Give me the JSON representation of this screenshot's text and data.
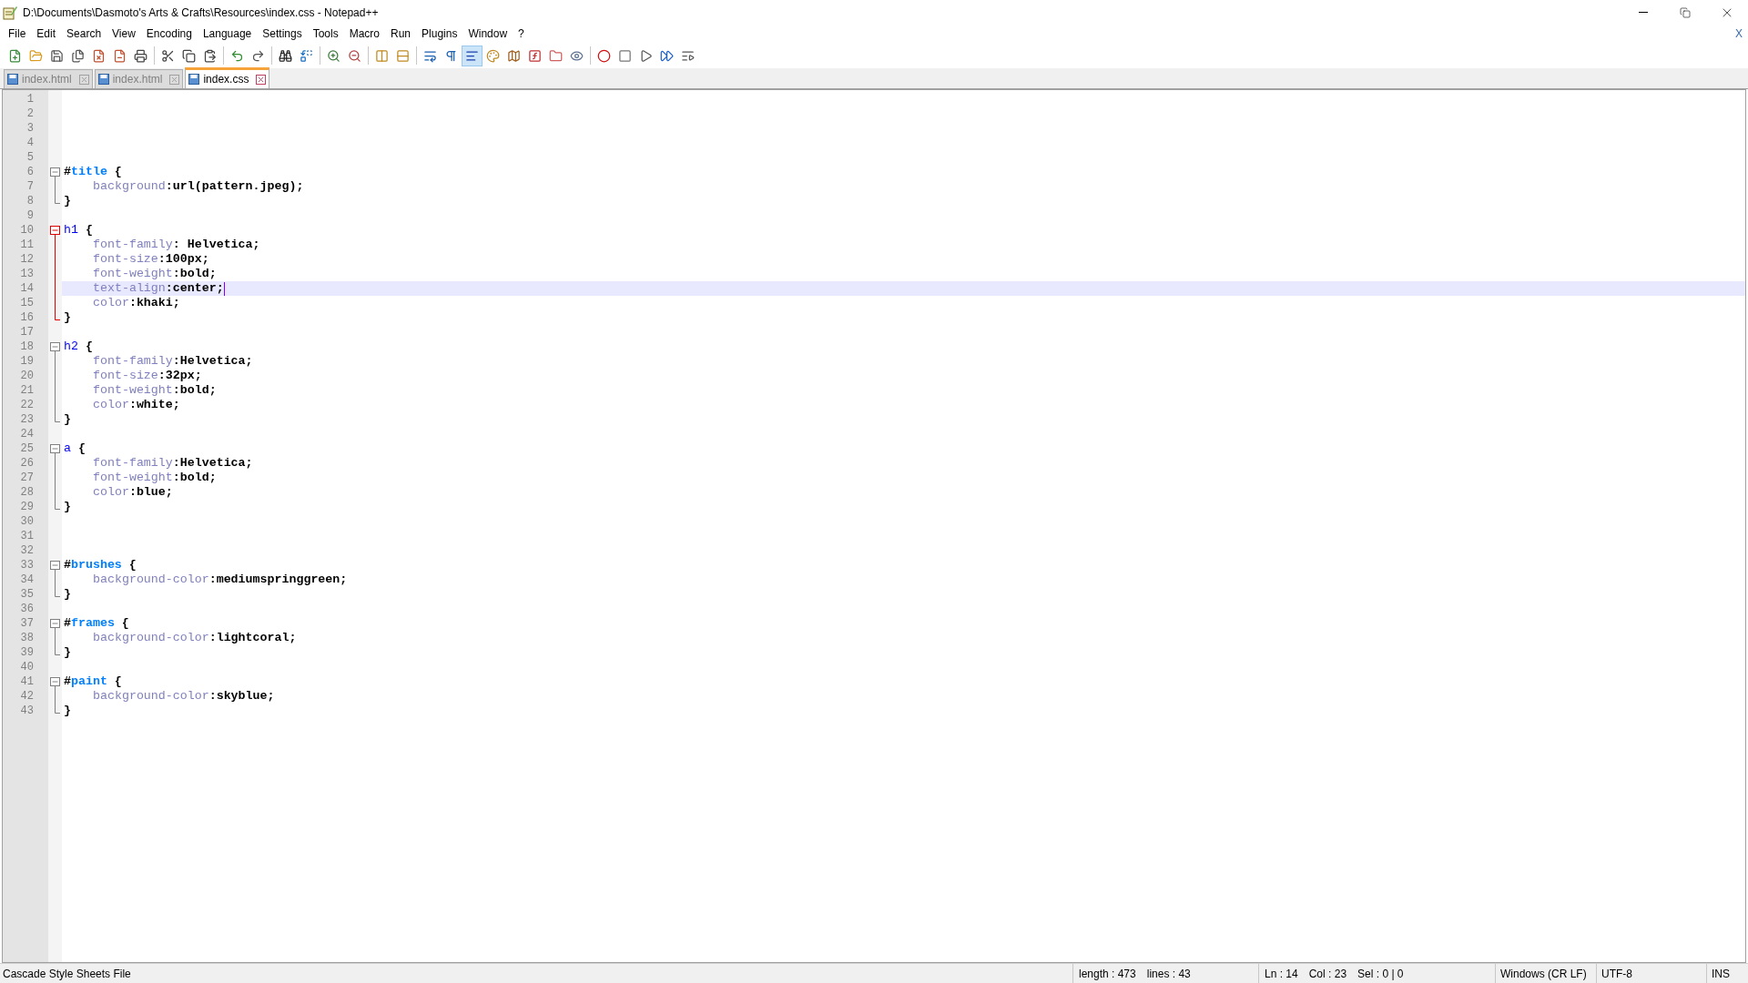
{
  "window": {
    "title": "D:\\Documents\\Dasmoto's Arts & Crafts\\Resources\\index.css - Notepad++"
  },
  "menu": [
    "File",
    "Edit",
    "Search",
    "View",
    "Encoding",
    "Language",
    "Settings",
    "Tools",
    "Macro",
    "Run",
    "Plugins",
    "Window",
    "?"
  ],
  "menu_close": "X",
  "toolbar_buttons": [
    {
      "pressed": false
    },
    {
      "pressed": false
    },
    {
      "pressed": false
    },
    {
      "pressed": false
    },
    {
      "pressed": false
    },
    {
      "pressed": false
    },
    {
      "pressed": false
    },
    {
      "pressed": false
    },
    {
      "pressed": false
    },
    {
      "pressed": false
    },
    {
      "pressed": false
    },
    {
      "pressed": false
    },
    {
      "pressed": false
    },
    {
      "pressed": false
    },
    {
      "pressed": false
    },
    {
      "pressed": false
    },
    {
      "pressed": false
    },
    {
      "pressed": false
    },
    {
      "pressed": false
    },
    {
      "pressed": false
    },
    {
      "pressed": true
    },
    {
      "pressed": false
    },
    {
      "pressed": false
    },
    {
      "pressed": false
    },
    {
      "pressed": false
    },
    {
      "pressed": false
    },
    {
      "pressed": false
    },
    {
      "pressed": false
    },
    {
      "pressed": false
    },
    {
      "pressed": false
    },
    {
      "pressed": false
    }
  ],
  "tabs": [
    {
      "label": "index.html",
      "selected": false
    },
    {
      "label": "index.html",
      "selected": false
    },
    {
      "label": "index.css",
      "selected": true
    }
  ],
  "lines": [
    {
      "number": "1",
      "kind": "blank",
      "current": false
    },
    {
      "number": "2",
      "kind": "blank",
      "current": false
    },
    {
      "number": "3",
      "kind": "blank",
      "current": false
    },
    {
      "number": "4",
      "kind": "blank",
      "current": false
    },
    {
      "number": "5",
      "kind": "blank",
      "current": false
    },
    {
      "number": "6",
      "kind": "open",
      "current": false,
      "fold_active": false,
      "tokens": [
        {
          "kind": "op",
          "text": "#"
        },
        {
          "kind": "id",
          "text": "title"
        },
        {
          "kind": "op",
          "text": " {"
        }
      ]
    },
    {
      "number": "7",
      "kind": "body",
      "current": false,
      "fold_active": false,
      "tokens": [
        {
          "kind": "prop",
          "text": "background"
        },
        {
          "kind": "value",
          "text": ":url(pattern.jpeg);"
        }
      ]
    },
    {
      "number": "8",
      "kind": "close",
      "current": false,
      "fold_active": false,
      "tokens": [
        {
          "kind": "op",
          "text": "}"
        }
      ]
    },
    {
      "number": "9",
      "kind": "blank",
      "current": false
    },
    {
      "number": "10",
      "kind": "open",
      "current": false,
      "fold_active": true,
      "tokens": [
        {
          "kind": "tag",
          "text": "h1"
        },
        {
          "kind": "op",
          "text": " {"
        }
      ]
    },
    {
      "number": "11",
      "kind": "body",
      "current": false,
      "fold_active": true,
      "tokens": [
        {
          "kind": "prop",
          "text": "font-family"
        },
        {
          "kind": "value",
          "text": ": Helvetica;"
        }
      ]
    },
    {
      "number": "12",
      "kind": "body",
      "current": false,
      "fold_active": true,
      "tokens": [
        {
          "kind": "prop",
          "text": "font-size"
        },
        {
          "kind": "value",
          "text": ":100px;"
        }
      ]
    },
    {
      "number": "13",
      "kind": "body",
      "current": false,
      "fold_active": true,
      "tokens": [
        {
          "kind": "prop",
          "text": "font-weight"
        },
        {
          "kind": "value",
          "text": ":bold;"
        }
      ]
    },
    {
      "number": "14",
      "kind": "body",
      "current": true,
      "fold_active": true,
      "tokens": [
        {
          "kind": "prop",
          "text": "text-align"
        },
        {
          "kind": "value",
          "text": ":center;"
        }
      ]
    },
    {
      "number": "15",
      "kind": "body",
      "current": false,
      "fold_active": true,
      "tokens": [
        {
          "kind": "prop",
          "text": "color"
        },
        {
          "kind": "value",
          "text": ":khaki;"
        }
      ]
    },
    {
      "number": "16",
      "kind": "close",
      "current": false,
      "fold_active": true,
      "tokens": [
        {
          "kind": "op",
          "text": "}"
        }
      ]
    },
    {
      "number": "17",
      "kind": "blank",
      "current": false
    },
    {
      "number": "18",
      "kind": "open",
      "current": false,
      "fold_active": false,
      "tokens": [
        {
          "kind": "tag",
          "text": "h2"
        },
        {
          "kind": "op",
          "text": " {"
        }
      ]
    },
    {
      "number": "19",
      "kind": "body",
      "current": false,
      "fold_active": false,
      "tokens": [
        {
          "kind": "prop",
          "text": "font-family"
        },
        {
          "kind": "value",
          "text": ":Helvetica;"
        }
      ]
    },
    {
      "number": "20",
      "kind": "body",
      "current": false,
      "fold_active": false,
      "tokens": [
        {
          "kind": "prop",
          "text": "font-size"
        },
        {
          "kind": "value",
          "text": ":32px;"
        }
      ]
    },
    {
      "number": "21",
      "kind": "body",
      "current": false,
      "fold_active": false,
      "tokens": [
        {
          "kind": "prop",
          "text": "font-weight"
        },
        {
          "kind": "value",
          "text": ":bold;"
        }
      ]
    },
    {
      "number": "22",
      "kind": "body",
      "current": false,
      "fold_active": false,
      "tokens": [
        {
          "kind": "prop",
          "text": "color"
        },
        {
          "kind": "value",
          "text": ":white;"
        }
      ]
    },
    {
      "number": "23",
      "kind": "close",
      "current": false,
      "fold_active": false,
      "tokens": [
        {
          "kind": "op",
          "text": "}"
        }
      ]
    },
    {
      "number": "24",
      "kind": "blank",
      "current": false
    },
    {
      "number": "25",
      "kind": "open",
      "current": false,
      "fold_active": false,
      "tokens": [
        {
          "kind": "tag",
          "text": "a"
        },
        {
          "kind": "op",
          "text": " {"
        }
      ]
    },
    {
      "number": "26",
      "kind": "body",
      "current": false,
      "fold_active": false,
      "tokens": [
        {
          "kind": "prop",
          "text": "font-family"
        },
        {
          "kind": "value",
          "text": ":Helvetica;"
        }
      ]
    },
    {
      "number": "27",
      "kind": "body",
      "current": false,
      "fold_active": false,
      "tokens": [
        {
          "kind": "prop",
          "text": "font-weight"
        },
        {
          "kind": "value",
          "text": ":bold;"
        }
      ]
    },
    {
      "number": "28",
      "kind": "body",
      "current": false,
      "fold_active": false,
      "tokens": [
        {
          "kind": "prop",
          "text": "color"
        },
        {
          "kind": "value",
          "text": ":blue;"
        }
      ]
    },
    {
      "number": "29",
      "kind": "close",
      "current": false,
      "fold_active": false,
      "tokens": [
        {
          "kind": "op",
          "text": "}"
        }
      ]
    },
    {
      "number": "30",
      "kind": "blank",
      "current": false
    },
    {
      "number": "31",
      "kind": "blank",
      "current": false
    },
    {
      "number": "32",
      "kind": "blank",
      "current": false
    },
    {
      "number": "33",
      "kind": "open",
      "current": false,
      "fold_active": false,
      "tokens": [
        {
          "kind": "op",
          "text": "#"
        },
        {
          "kind": "id",
          "text": "brushes"
        },
        {
          "kind": "op",
          "text": " {"
        }
      ]
    },
    {
      "number": "34",
      "kind": "body",
      "current": false,
      "fold_active": false,
      "tokens": [
        {
          "kind": "prop",
          "text": "background-color"
        },
        {
          "kind": "value",
          "text": ":mediumspringgreen;"
        }
      ]
    },
    {
      "number": "35",
      "kind": "close",
      "current": false,
      "fold_active": false,
      "tokens": [
        {
          "kind": "op",
          "text": "}"
        }
      ]
    },
    {
      "number": "36",
      "kind": "blank",
      "current": false
    },
    {
      "number": "37",
      "kind": "open",
      "current": false,
      "fold_active": false,
      "tokens": [
        {
          "kind": "op",
          "text": "#"
        },
        {
          "kind": "id",
          "text": "frames"
        },
        {
          "kind": "op",
          "text": " {"
        }
      ]
    },
    {
      "number": "38",
      "kind": "body",
      "current": false,
      "fold_active": false,
      "tokens": [
        {
          "kind": "prop",
          "text": "background-color"
        },
        {
          "kind": "value",
          "text": ":lightcoral;"
        }
      ]
    },
    {
      "number": "39",
      "kind": "close",
      "current": false,
      "fold_active": false,
      "tokens": [
        {
          "kind": "op",
          "text": "}"
        }
      ]
    },
    {
      "number": "40",
      "kind": "blank",
      "current": false
    },
    {
      "number": "41",
      "kind": "open",
      "current": false,
      "fold_active": false,
      "tokens": [
        {
          "kind": "op",
          "text": "#"
        },
        {
          "kind": "id",
          "text": "paint"
        },
        {
          "kind": "op",
          "text": " {"
        }
      ]
    },
    {
      "number": "42",
      "kind": "body",
      "current": false,
      "fold_active": false,
      "tokens": [
        {
          "kind": "prop",
          "text": "background-color"
        },
        {
          "kind": "value",
          "text": ":skyblue;"
        }
      ]
    },
    {
      "number": "43",
      "kind": "close",
      "current": false,
      "fold_active": false,
      "tokens": [
        {
          "kind": "op",
          "text": "}"
        }
      ]
    }
  ],
  "status_bar": {
    "file_type": "Cascade Style Sheets File",
    "length": "length : 473",
    "lines": "lines : 43",
    "ln": "Ln : 14",
    "col": "Col : 23",
    "sel": "Sel : 0 | 0",
    "eol": "Windows (CR LF)",
    "encoding": "UTF-8",
    "mode": "INS"
  }
}
